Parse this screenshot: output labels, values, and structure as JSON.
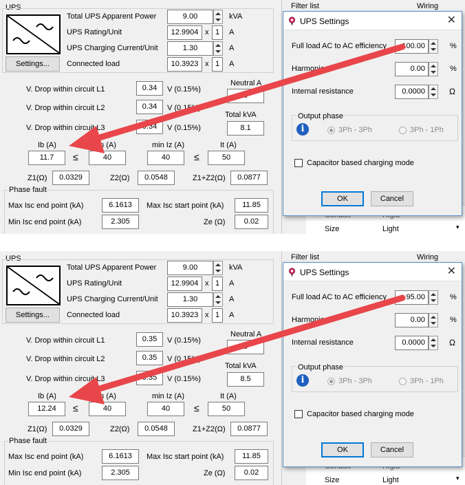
{
  "panels": [
    {
      "ups_section_title": "UPS",
      "total_apparent_power_label": "Total UPS Apparent Power",
      "total_apparent_power_value": "9.00",
      "total_apparent_power_unit": "kVA",
      "rating_label": "UPS Rating/Unit",
      "rating_value": "12.9904",
      "rating_multiplier": "x",
      "rating_count": "1",
      "rating_unit": "A",
      "charging_label": "UPS Charging Current/Unit",
      "charging_value": "1.30",
      "charging_unit": "A",
      "connected_label": "Connected load",
      "connected_value": "10.3923",
      "connected_multiplier": "x",
      "connected_count": "1",
      "connected_unit": "A",
      "settings_button": "Settings...",
      "vdrop_l1_label": "V. Drop within circuit L1",
      "vdrop_l1_value": "0.34",
      "vdrop_l1_pct": "V (0.15%)",
      "vdrop_l2_label": "V. Drop within circuit L2",
      "vdrop_l2_value": "0.34",
      "vdrop_l2_pct": "V (0.15%)",
      "vdrop_l3_label": "V. Drop within circuit L3",
      "vdrop_l3_value": "0.34",
      "vdrop_l3_pct": "V (0.15%)",
      "neutral_label": "Neutral A",
      "neutral_value": "0",
      "total_kva_label": "Total kVA",
      "total_kva_value": "8.1",
      "ib_label": "Ib (A)",
      "ib_value": "11.7",
      "le1": "≤",
      "in_label": "In (A)",
      "in_value": "40",
      "miniz_label": "min Iz (A)",
      "miniz_value": "40",
      "le2": "≤",
      "it_label": "It (A)",
      "it_value": "50",
      "z1_label": "Z1(Ω)",
      "z1_value": "0.0329",
      "z2_label": "Z2(Ω)",
      "z2_value": "0.0548",
      "z1z2_label": "Z1+Z2(Ω)",
      "z1z2_value": "0.0877",
      "phase_fault_title": "Phase fault",
      "max_isc_end_label": "Max Isc end point (kA)",
      "max_isc_end_value": "6.1613",
      "max_isc_start_label": "Max Isc start point (kA)",
      "max_isc_start_value": "11.85",
      "min_isc_end_label": "Min Isc end point (kA)",
      "min_isc_end_value": "2.305",
      "ze_label": "Ze (Ω)",
      "ze_value": "0.02",
      "filter_list_label": "Filter list",
      "wiring_label": "Wiring",
      "bg_prop_conduit": "Conduit",
      "bg_prop_conduit_val": "Rigid",
      "bg_prop_size": "Size",
      "bg_prop_size_val": "Light",
      "dialog": {
        "title": "UPS Settings",
        "efficiency_label": "Full load AC to AC efficiency",
        "efficiency_value": "100.00",
        "efficiency_unit": "%",
        "harmonics_label": "Harmonics",
        "harmonics_value": "0.00",
        "harmonics_unit": "%",
        "resistance_label": "Internal resistance",
        "resistance_value": "0.0000",
        "resistance_unit": "Ω",
        "output_phase_title": "Output phase",
        "radio_3ph3ph": "3Ph - 3Ph",
        "radio_3ph1ph": "3Ph - 1Ph",
        "capacitor_label": "Capacitor based charging mode",
        "ok_button": "OK",
        "cancel_button": "Cancel"
      }
    },
    {
      "ups_section_title": "UPS",
      "total_apparent_power_label": "Total UPS Apparent Power",
      "total_apparent_power_value": "9.00",
      "total_apparent_power_unit": "kVA",
      "rating_label": "UPS Rating/Unit",
      "rating_value": "12.9904",
      "rating_multiplier": "x",
      "rating_count": "1",
      "rating_unit": "A",
      "charging_label": "UPS Charging Current/Unit",
      "charging_value": "1.30",
      "charging_unit": "A",
      "connected_label": "Connected load",
      "connected_value": "10.3923",
      "connected_multiplier": "x",
      "connected_count": "1",
      "connected_unit": "A",
      "settings_button": "Settings...",
      "vdrop_l1_label": "V. Drop within circuit L1",
      "vdrop_l1_value": "0.35",
      "vdrop_l1_pct": "V (0.15%)",
      "vdrop_l2_label": "V. Drop within circuit L2",
      "vdrop_l2_value": "0.35",
      "vdrop_l2_pct": "V (0.15%)",
      "vdrop_l3_label": "V. Drop within circuit L3",
      "vdrop_l3_value": "0.35",
      "vdrop_l3_pct": "V (0.15%)",
      "neutral_label": "Neutral A",
      "neutral_value": "0",
      "total_kva_label": "Total kVA",
      "total_kva_value": "8.5",
      "ib_label": "Ib (A)",
      "ib_value": "12.24",
      "le1": "≤",
      "in_label": "In (A)",
      "in_value": "40",
      "miniz_label": "min Iz (A)",
      "miniz_value": "40",
      "le2": "≤",
      "it_label": "It (A)",
      "it_value": "50",
      "z1_label": "Z1(Ω)",
      "z1_value": "0.0329",
      "z2_label": "Z2(Ω)",
      "z2_value": "0.0548",
      "z1z2_label": "Z1+Z2(Ω)",
      "z1z2_value": "0.0877",
      "phase_fault_title": "Phase fault",
      "max_isc_end_label": "Max Isc end point (kA)",
      "max_isc_end_value": "6.1613",
      "max_isc_start_label": "Max Isc start point (kA)",
      "max_isc_start_value": "11.85",
      "min_isc_end_label": "Min Isc end point (kA)",
      "min_isc_end_value": "2.305",
      "ze_label": "Ze (Ω)",
      "ze_value": "0.02",
      "filter_list_label": "Filter list",
      "wiring_label": "Wiring",
      "bg_prop_conduit": "Conduit",
      "bg_prop_conduit_val": "Rigid",
      "bg_prop_size": "Size",
      "bg_prop_size_val": "Light",
      "dialog": {
        "title": "UPS Settings",
        "efficiency_label": "Full load AC to AC efficiency",
        "efficiency_value": "95.00",
        "efficiency_unit": "%",
        "harmonics_label": "Harmonics",
        "harmonics_value": "0.00",
        "harmonics_unit": "%",
        "resistance_label": "Internal resistance",
        "resistance_value": "0.0000",
        "resistance_unit": "Ω",
        "output_phase_title": "Output phase",
        "radio_3ph3ph": "3Ph - 3Ph",
        "radio_3ph1ph": "3Ph - 1Ph",
        "capacitor_label": "Capacitor based charging mode",
        "ok_button": "OK",
        "cancel_button": "Cancel"
      }
    }
  ],
  "colors": {
    "arrow": "#e8464a",
    "dialog_border": "#5a8fc8",
    "info_icon": "#1f5fbf"
  },
  "icons": [
    "ups-icon",
    "ups-settings-icon",
    "info-icon",
    "close-icon",
    "spin-up-icon",
    "spin-down-icon",
    "dropdown-arrow-icon"
  ]
}
